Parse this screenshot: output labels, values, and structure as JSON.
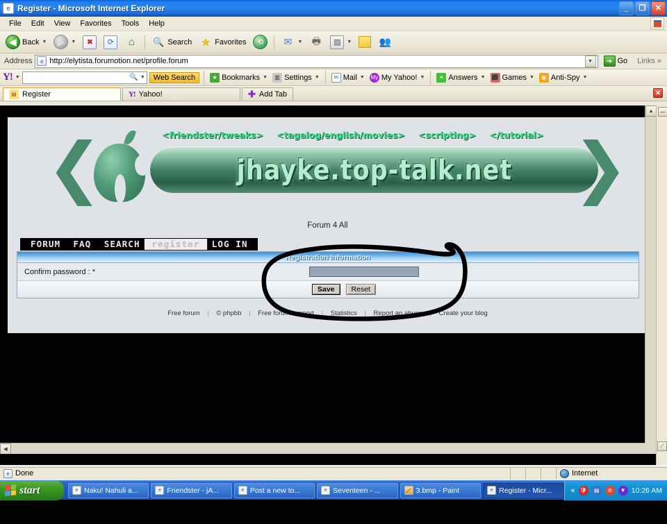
{
  "window": {
    "title": "Register - Microsoft Internet Explorer",
    "icon": "ie-page-icon",
    "minimize": "_",
    "maximize": "❐",
    "close": "✕"
  },
  "menu": {
    "items": [
      "File",
      "Edit",
      "View",
      "Favorites",
      "Tools",
      "Help"
    ]
  },
  "toolbar": {
    "back": "Back",
    "search": "Search",
    "favorites": "Favorites",
    "icons": [
      "back-arrow",
      "forward-arrow",
      "stop",
      "refresh",
      "home",
      "search",
      "favorites",
      "history",
      "mail",
      "print",
      "edit",
      "note",
      "messenger"
    ]
  },
  "address": {
    "label": "Address",
    "url": "http://elytista.forumotion.net/profile.forum",
    "go": "Go",
    "links": "Links"
  },
  "yahoo_toolbar": {
    "logo": "Y!",
    "search_value": "",
    "web_search": "Web Search",
    "items": [
      {
        "label": "Bookmarks",
        "icon": "bookmarks-icon"
      },
      {
        "label": "Settings",
        "icon": "settings-icon"
      },
      {
        "label": "Mail",
        "icon": "mail-icon"
      },
      {
        "label": "My Yahoo!",
        "icon": "my-yahoo-icon"
      },
      {
        "label": "Answers",
        "icon": "answers-icon"
      },
      {
        "label": "Games",
        "icon": "games-icon"
      },
      {
        "label": "Anti-Spy",
        "icon": "anti-spy-icon"
      }
    ]
  },
  "tabs": {
    "items": [
      {
        "label": "Register",
        "icon": "register-page-icon",
        "active": true
      },
      {
        "label": "Yahoo!",
        "icon": "yahoo-icon",
        "active": false
      }
    ],
    "add_tab": "Add Tab",
    "close": "✕"
  },
  "page": {
    "banner": {
      "logo_text": "jhayke.top-talk.net",
      "nav_links": [
        "<friendster/tweaks>",
        "<tagalog/english/movies>",
        "<scripting>",
        "</tutorial>"
      ],
      "apple_icon": "apple-logo"
    },
    "site_tagline": "Forum 4 All",
    "forum_nav": [
      {
        "label": "FORUM",
        "active": false
      },
      {
        "label": "FAQ",
        "active": false
      },
      {
        "label": "SEARCH",
        "active": false
      },
      {
        "label": "register",
        "active": true
      },
      {
        "label": "LOG IN",
        "active": false
      }
    ],
    "registration": {
      "header": "Registration Information",
      "field_label": "Confirm password : *",
      "field_value": "",
      "save": "Save",
      "reset": "Reset"
    },
    "footer_links": [
      "Free forum",
      "© phpbb",
      "Free forum support",
      "Statistics",
      "Report an abuse",
      "Create your blog"
    ],
    "footer_separator": "|",
    "annotation": "hand-drawn-circle"
  },
  "status": {
    "text": "Done",
    "zone": "Internet",
    "zone_icon": "globe-icon"
  },
  "taskbar": {
    "start": "start",
    "items": [
      {
        "label": "Naku! Nahuli a...",
        "icon": "ie-icon",
        "active": false
      },
      {
        "label": "Friendster - jA...",
        "icon": "ie-icon",
        "active": false
      },
      {
        "label": "Post a new to...",
        "icon": "ie-icon",
        "active": false
      },
      {
        "label": "Seventeen - ...",
        "icon": "ie-icon",
        "active": false
      },
      {
        "label": "3.bmp - Paint",
        "icon": "paint-icon",
        "active": false
      },
      {
        "label": "Register - Micr...",
        "icon": "ie-icon",
        "active": true
      }
    ],
    "tray_icons": [
      "show-hidden-chevron",
      "security-shield-icon",
      "network-icon",
      "block-icon",
      "antispy-icon"
    ],
    "clock": "10:26 AM"
  },
  "colors": {
    "title_blue": "#1f7ceb",
    "taskbar_blue": "#2158bb",
    "start_green": "#3f9a28",
    "banner_green": "#4a8a6c",
    "link_green": "#3fd98a",
    "header_blue": "#62aee8",
    "annotation_black": "#000000"
  }
}
